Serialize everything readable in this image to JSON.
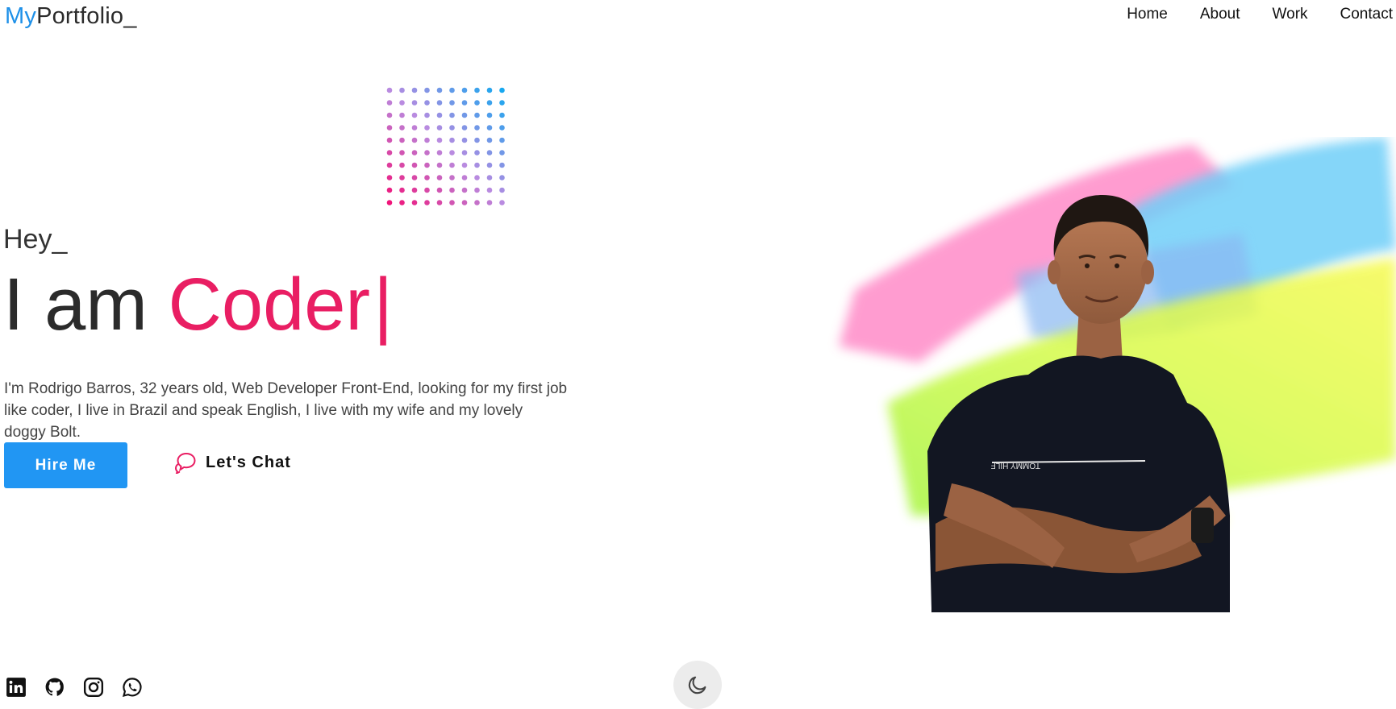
{
  "header": {
    "logo_prefix": "My",
    "logo_suffix": "Portfolio_",
    "nav": [
      {
        "label": "Home"
      },
      {
        "label": "About"
      },
      {
        "label": "Work"
      },
      {
        "label": "Contact"
      }
    ]
  },
  "hero": {
    "greeting": "Hey_",
    "headline_prefix": "I am ",
    "headline_accent": "Coder",
    "cursor": "|",
    "bio": "I'm Rodrigo Barros, 32 years old, Web Developer Front-End, looking for my first job like coder, I live in Brazil and speak English, I live with my wife and my lovely doggy Bolt.",
    "primary_button": "Hire Me",
    "secondary_button": "Let's Chat",
    "shirt_text": "TOMMY HILF"
  },
  "icons": {
    "social": [
      "linkedin-icon",
      "github-icon",
      "instagram-icon",
      "whatsapp-icon"
    ],
    "chat": "chat-bubbles-icon",
    "theme": "moon-icon"
  },
  "colors": {
    "brand_blue": "#2196f3",
    "accent_pink": "#e91e63",
    "text_dark": "#2b2b2b"
  }
}
